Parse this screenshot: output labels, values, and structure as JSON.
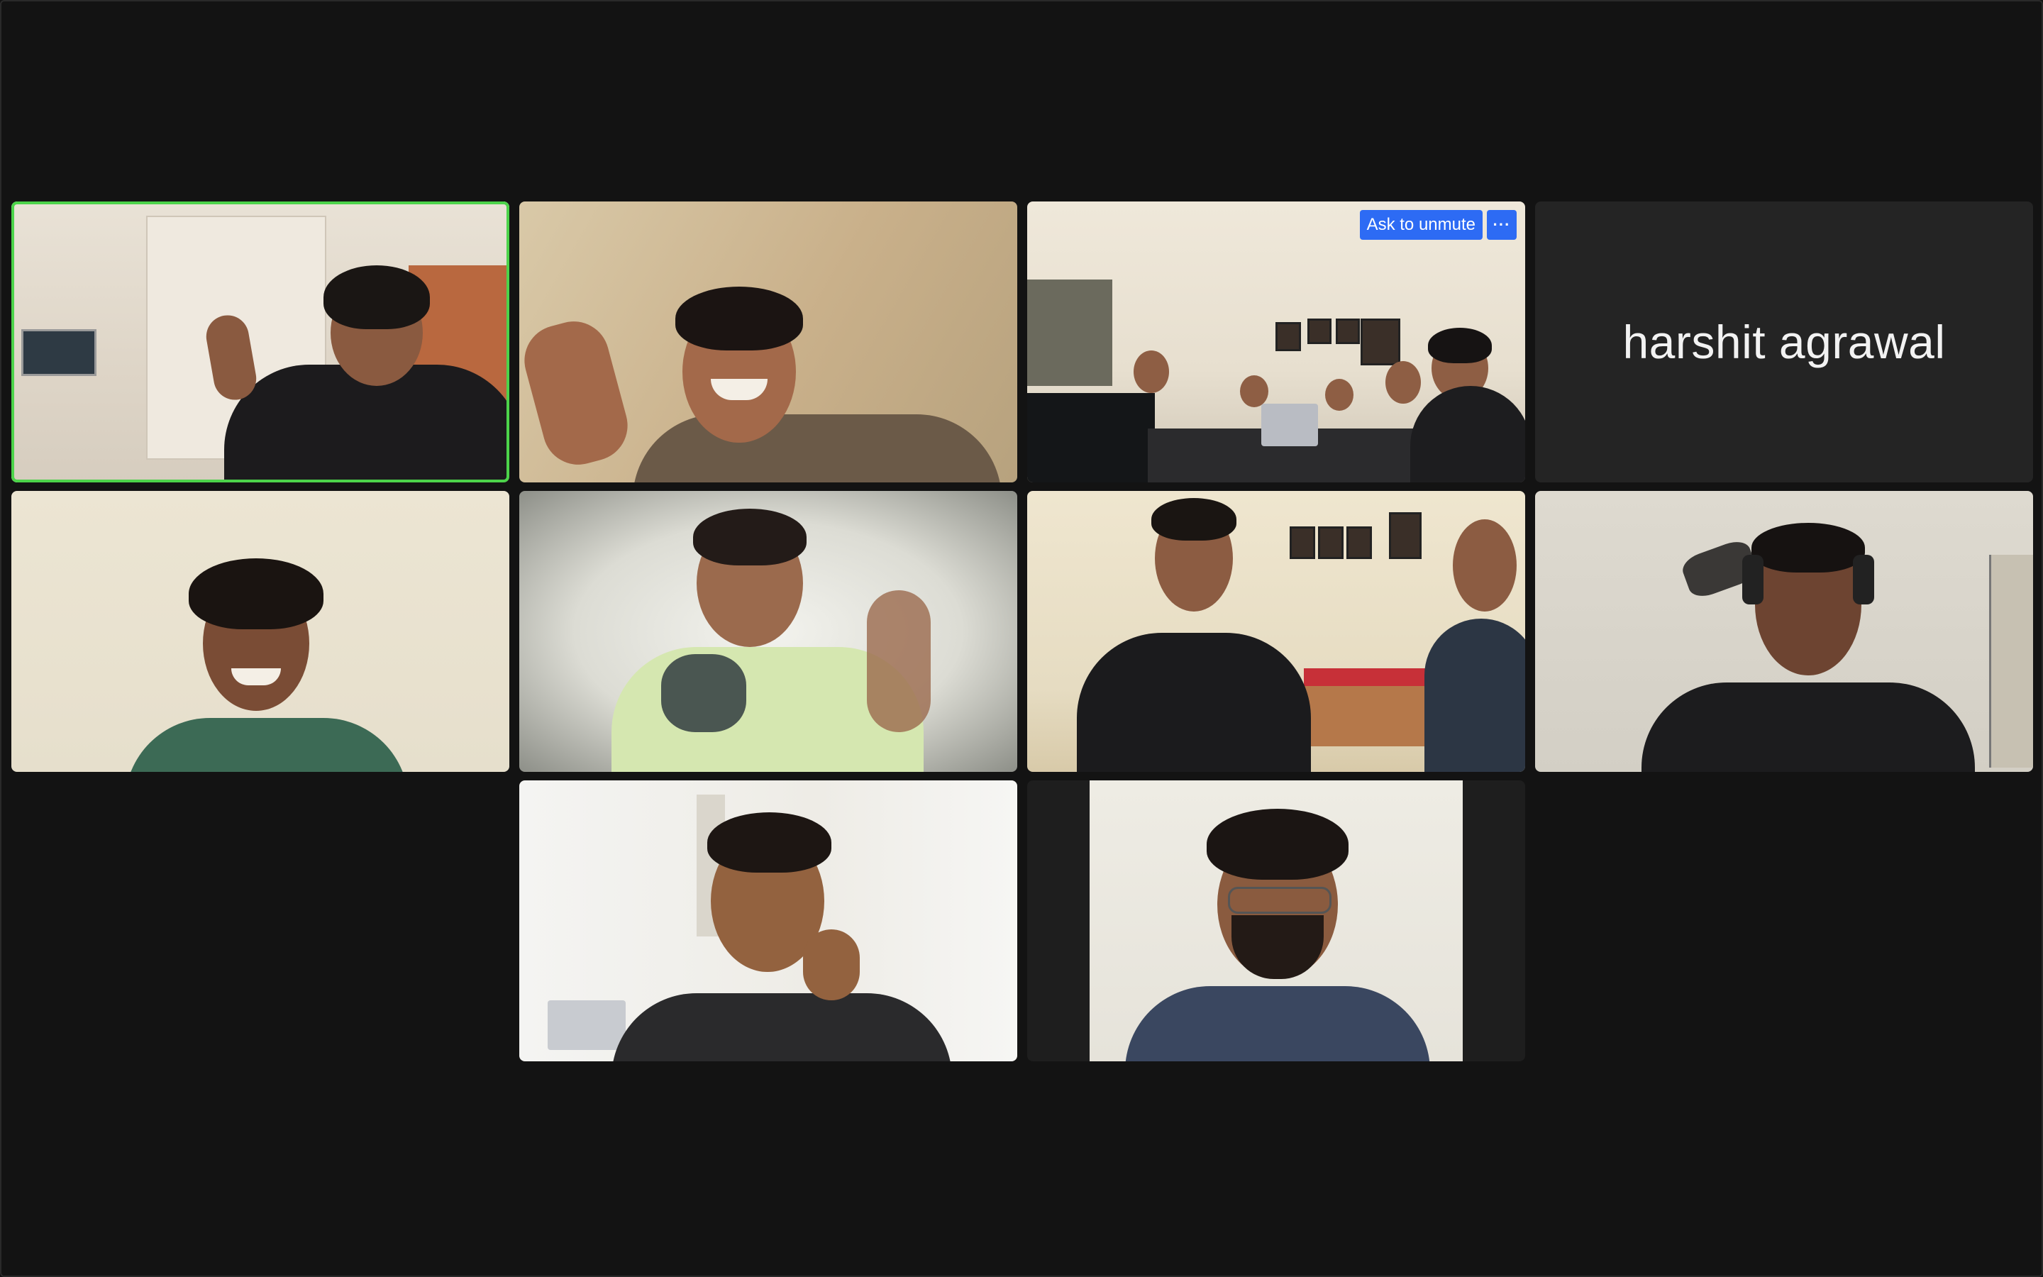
{
  "tiles": [
    {
      "name": "participant-1",
      "active": true
    },
    {
      "name": "participant-2"
    },
    {
      "name": "participant-3-group",
      "ask_unmute_label": "Ask to unmute",
      "more_label": "···"
    },
    {
      "name": "participant-4",
      "display_name": "harshit agrawal"
    },
    {
      "name": "participant-5"
    },
    {
      "name": "participant-6"
    },
    {
      "name": "participant-7"
    },
    {
      "name": "participant-8"
    },
    {
      "name": "participant-9"
    },
    {
      "name": "participant-10"
    }
  ],
  "colors": {
    "background": "#131313",
    "tile_empty": "#242424",
    "active_speaker_border": "#4cd34a",
    "button_blue": "#2d6bf4"
  }
}
